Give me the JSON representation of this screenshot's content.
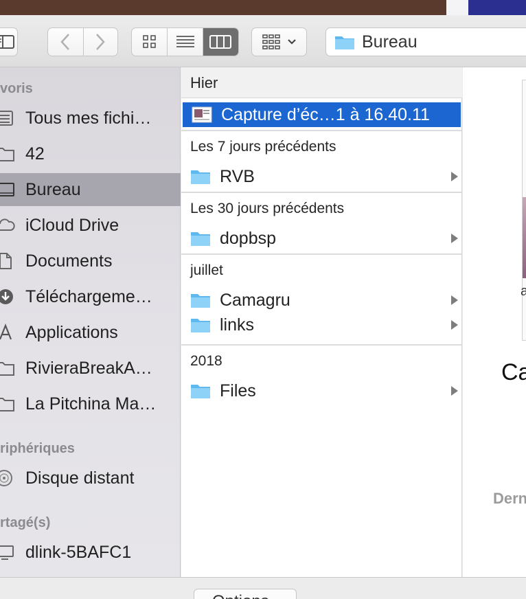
{
  "toolbar": {
    "path_label": "Bureau"
  },
  "sidebar": {
    "sections": [
      {
        "header": "voris",
        "items": [
          "Tous mes fichi…",
          "42",
          "Bureau",
          "iCloud Drive",
          "Documents",
          "Téléchargeme…",
          "Applications",
          "RivieraBreakA…",
          "La Pitchina Ma…"
        ]
      },
      {
        "header": "riphériques",
        "items": [
          "Disque distant"
        ]
      },
      {
        "header": "rtagé(s)",
        "items": [
          "dlink-5BAFC1"
        ]
      }
    ],
    "selected": "Bureau"
  },
  "column": {
    "groups": [
      {
        "title": "Hier",
        "rows": [
          {
            "name": "Capture d’éc…1 à 16.40.11",
            "type": "image",
            "selected": true
          }
        ]
      },
      {
        "title": "Les 7 jours précédents",
        "rows": [
          {
            "name": "RVB",
            "type": "folder"
          }
        ]
      },
      {
        "title": "Les 30 jours précédents",
        "rows": [
          {
            "name": "dopbsp",
            "type": "folder"
          }
        ]
      },
      {
        "title": "juillet",
        "rows": [
          {
            "name": "Camagru",
            "type": "folder"
          },
          {
            "name": "links",
            "type": "folder"
          }
        ]
      },
      {
        "title": "2018",
        "rows": [
          {
            "name": "Files",
            "type": "folder"
          }
        ]
      }
    ]
  },
  "preview": {
    "thumb_letter": "a",
    "name": "Ca",
    "meta": "Dern"
  },
  "bottom": {
    "partial_text": "",
    "options_button": "Options"
  },
  "colors": {
    "selection": "#1b66d1",
    "sidebar_selected": "#a7a6ae",
    "folder": "#6cc3f2"
  }
}
